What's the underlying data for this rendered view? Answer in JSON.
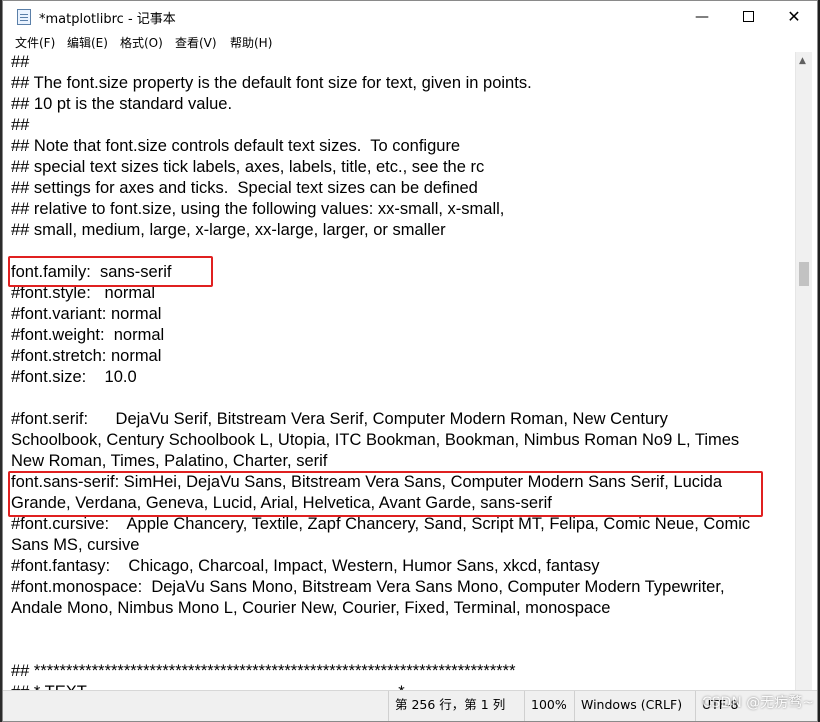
{
  "window": {
    "title": "*matplotlibrc - 记事本",
    "minimize_icon": "minimize-icon",
    "maximize_icon": "maximize-icon",
    "close_icon": "close-icon"
  },
  "menu": [
    {
      "label": "文件(F)"
    },
    {
      "label": "编辑(E)"
    },
    {
      "label": "格式(O)"
    },
    {
      "label": "查看(V)"
    },
    {
      "label": "帮助(H)"
    }
  ],
  "editor": {
    "lines": [
      "##",
      "## The font.size property is the default font size for text, given in points.",
      "## 10 pt is the standard value.",
      "##",
      "## Note that font.size controls default text sizes.  To configure",
      "## special text sizes tick labels, axes, labels, title, etc., see the rc",
      "## settings for axes and ticks.  Special text sizes can be defined",
      "## relative to font.size, using the following values: xx-small, x-small,",
      "## small, medium, large, x-large, xx-large, larger, or smaller",
      "",
      "font.family:  sans-serif",
      "#font.style:   normal",
      "#font.variant: normal",
      "#font.weight:  normal",
      "#font.stretch: normal",
      "#font.size:    10.0",
      "",
      "#font.serif:      DejaVu Serif, Bitstream Vera Serif, Computer Modern Roman, New Century",
      "Schoolbook, Century Schoolbook L, Utopia, ITC Bookman, Bookman, Nimbus Roman No9 L, Times",
      "New Roman, Times, Palatino, Charter, serif",
      "font.sans-serif: SimHei, DejaVu Sans, Bitstream Vera Sans, Computer Modern Sans Serif, Lucida",
      "Grande, Verdana, Geneva, Lucid, Arial, Helvetica, Avant Garde, sans-serif",
      "#font.cursive:    Apple Chancery, Textile, Zapf Chancery, Sand, Script MT, Felipa, Comic Neue, Comic",
      "Sans MS, cursive",
      "#font.fantasy:    Chicago, Charcoal, Impact, Western, Humor Sans, xkcd, fantasy",
      "#font.monospace:  DejaVu Sans Mono, Bitstream Vera Sans Mono, Computer Modern Typewriter,",
      "Andale Mono, Nimbus Mono L, Courier New, Courier, Fixed, Terminal, monospace",
      "",
      "",
      "## ***************************************************************************",
      "## * TEXT                                                                    *"
    ]
  },
  "statusbar": {
    "position": "第 256 行，第 1 列",
    "zoom": "100%",
    "line_ending": "Windows (CRLF)",
    "encoding": "UTF-8"
  },
  "watermark": "CSDN @无疠骛~",
  "colors": {
    "highlight": "#e02020",
    "background": "#ffffff"
  }
}
